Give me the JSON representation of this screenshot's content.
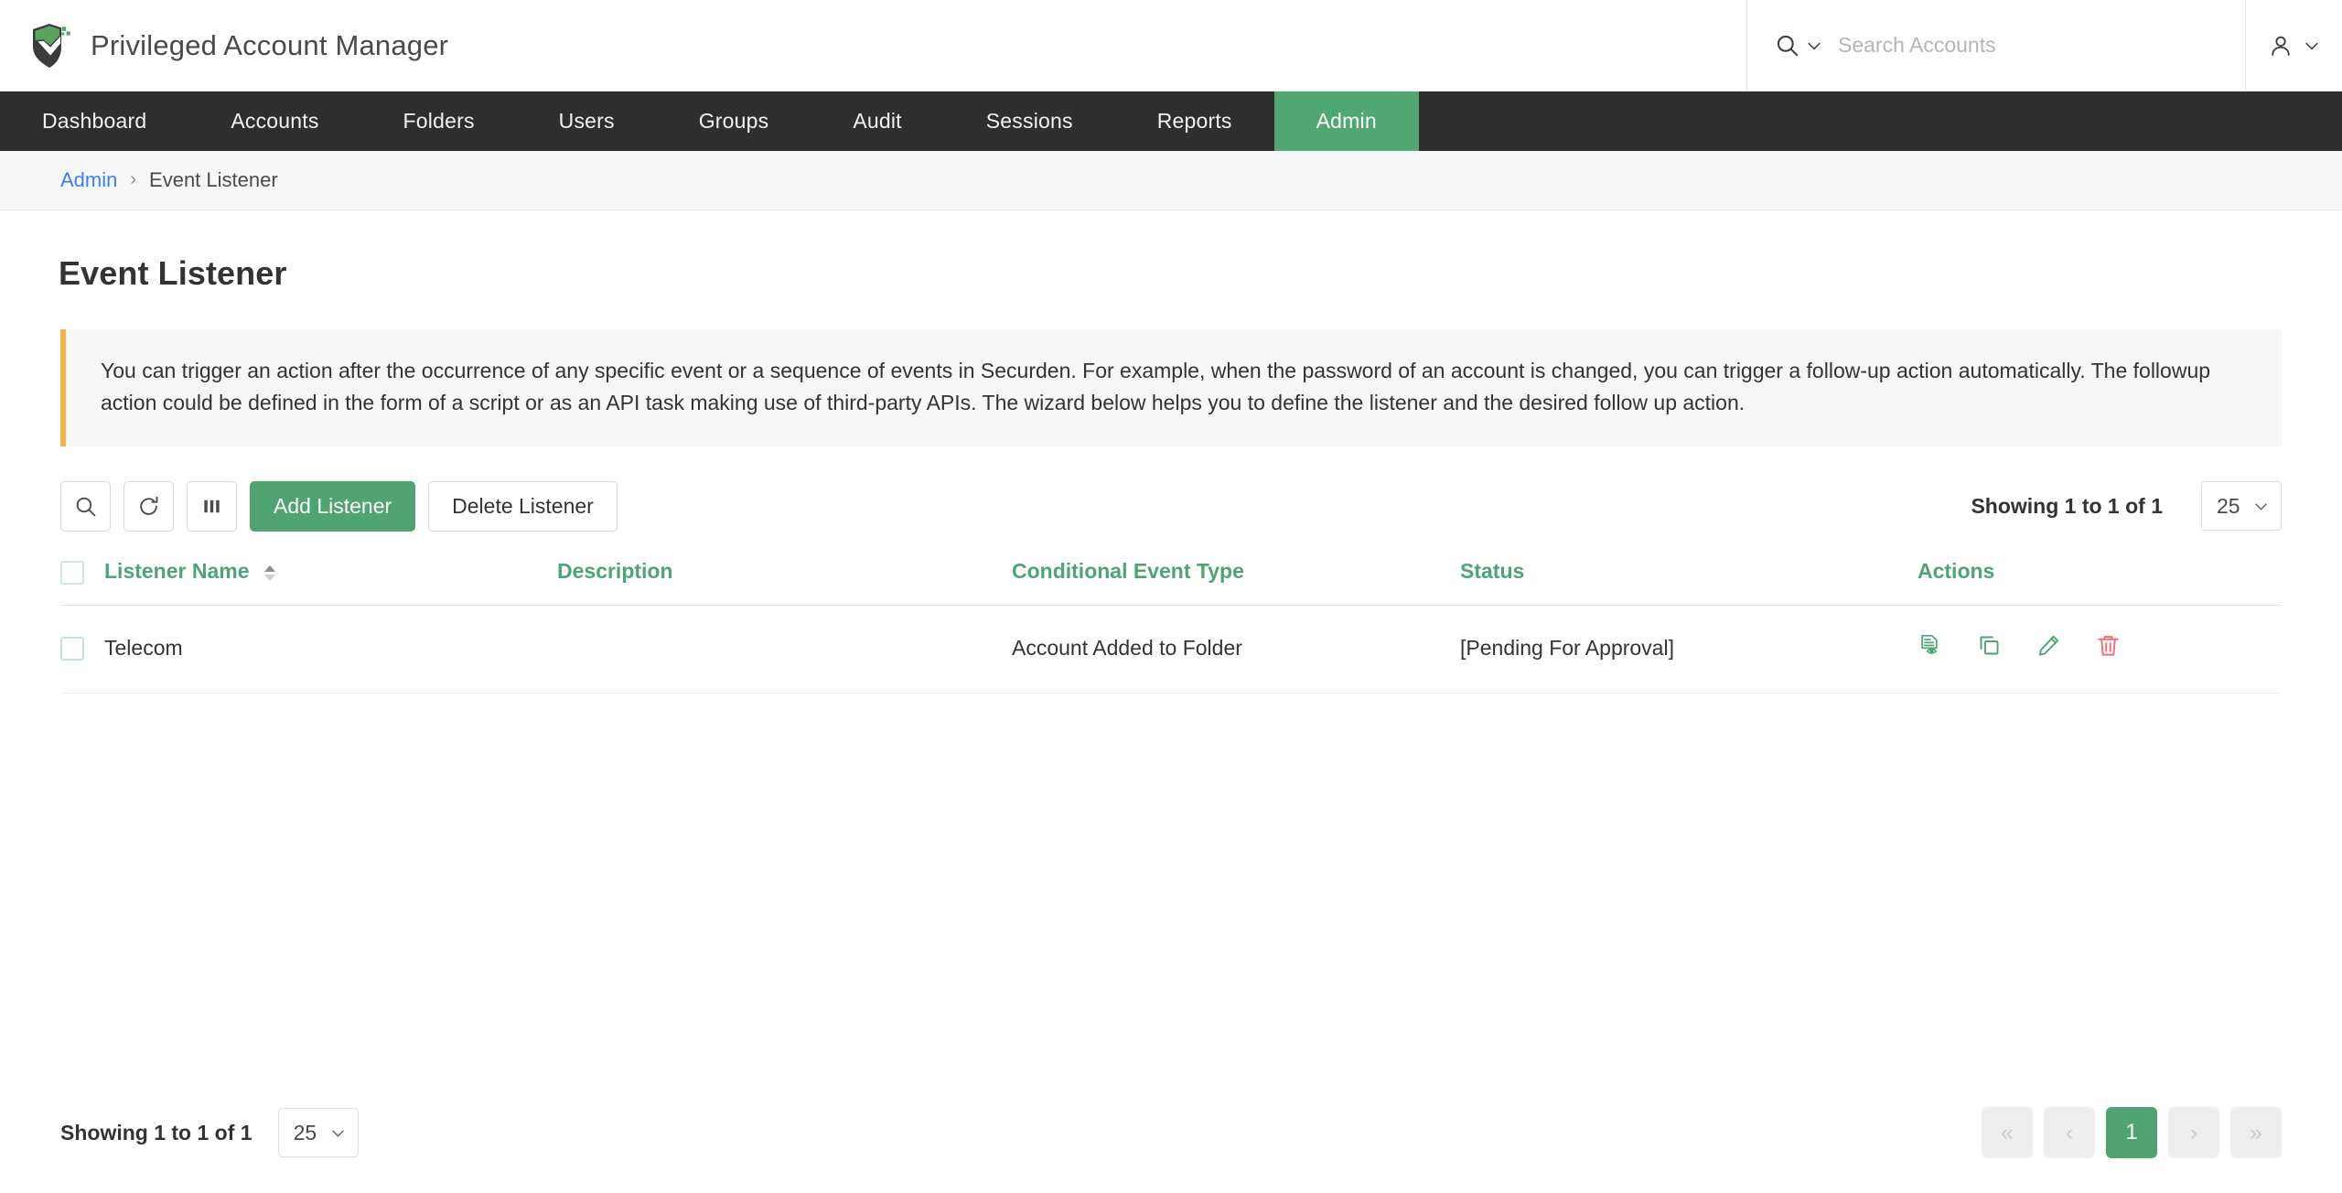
{
  "header": {
    "logo_icon": "securden-shield-logo",
    "app_title": "Privileged Account Manager",
    "search": {
      "icon": "search-icon",
      "dropdown_icon": "chevron-down-icon",
      "placeholder": "Search Accounts",
      "value": ""
    },
    "user_menu": {
      "icon": "user-icon",
      "dropdown_icon": "chevron-down-icon"
    }
  },
  "nav": {
    "items": [
      {
        "label": "Dashboard",
        "active": false
      },
      {
        "label": "Accounts",
        "active": false
      },
      {
        "label": "Folders",
        "active": false
      },
      {
        "label": "Users",
        "active": false
      },
      {
        "label": "Groups",
        "active": false
      },
      {
        "label": "Audit",
        "active": false
      },
      {
        "label": "Sessions",
        "active": false
      },
      {
        "label": "Reports",
        "active": false
      },
      {
        "label": "Admin",
        "active": true
      }
    ],
    "active_color": "#50a771",
    "bar_color": "#2e2e2e"
  },
  "breadcrumb": {
    "parent": "Admin",
    "separator": "›",
    "current": "Event Listener",
    "link_color": "#3b7df7"
  },
  "page": {
    "title": "Event Listener",
    "info_banner": {
      "accent_color": "#f3b44c",
      "text": "You can trigger an action after the occurrence of any specific event or a sequence of events in Securden. For example, when the password of an account is changed, you can trigger a follow-up action automatically. The followup action could be defined in the form of a script or as an API task making use of third-party APIs. The wizard below helps you to define the listener and the desired follow up action."
    }
  },
  "toolbar": {
    "search_icon": "search-icon",
    "refresh_icon": "refresh-icon",
    "columns_icon": "columns-icon",
    "add_label": "Add Listener",
    "delete_label": "Delete Listener",
    "showing_text": "Showing 1 to 1 of 1",
    "page_size": "25",
    "page_size_caret": "chevron-down-icon"
  },
  "table": {
    "columns": [
      {
        "label": "Listener Name",
        "sortable": true
      },
      {
        "label": "Description",
        "sortable": false
      },
      {
        "label": "Conditional Event Type",
        "sortable": false
      },
      {
        "label": "Status",
        "sortable": false
      },
      {
        "label": "Actions",
        "sortable": false
      }
    ],
    "header_color": "#4fa474",
    "rows": [
      {
        "selected": false,
        "listener_name": "Telecom",
        "description": "",
        "conditional_event_type": "Account Added to Folder",
        "status": "[Pending For Approval]",
        "actions": [
          {
            "icon": "view-details-icon",
            "color": "#4fa474"
          },
          {
            "icon": "clone-icon",
            "color": "#4fa474"
          },
          {
            "icon": "edit-pencil-icon",
            "color": "#4fa474"
          },
          {
            "icon": "delete-trash-icon",
            "color": "#ef6f6f"
          }
        ]
      }
    ]
  },
  "footer": {
    "showing_text": "Showing 1 to 1 of 1",
    "page_size": "25",
    "page_size_caret": "chevron-down-icon",
    "pager": {
      "first_label": "«",
      "prev_label": "‹",
      "pages": [
        "1"
      ],
      "current_page": "1",
      "next_label": "›",
      "last_label": "»"
    }
  }
}
